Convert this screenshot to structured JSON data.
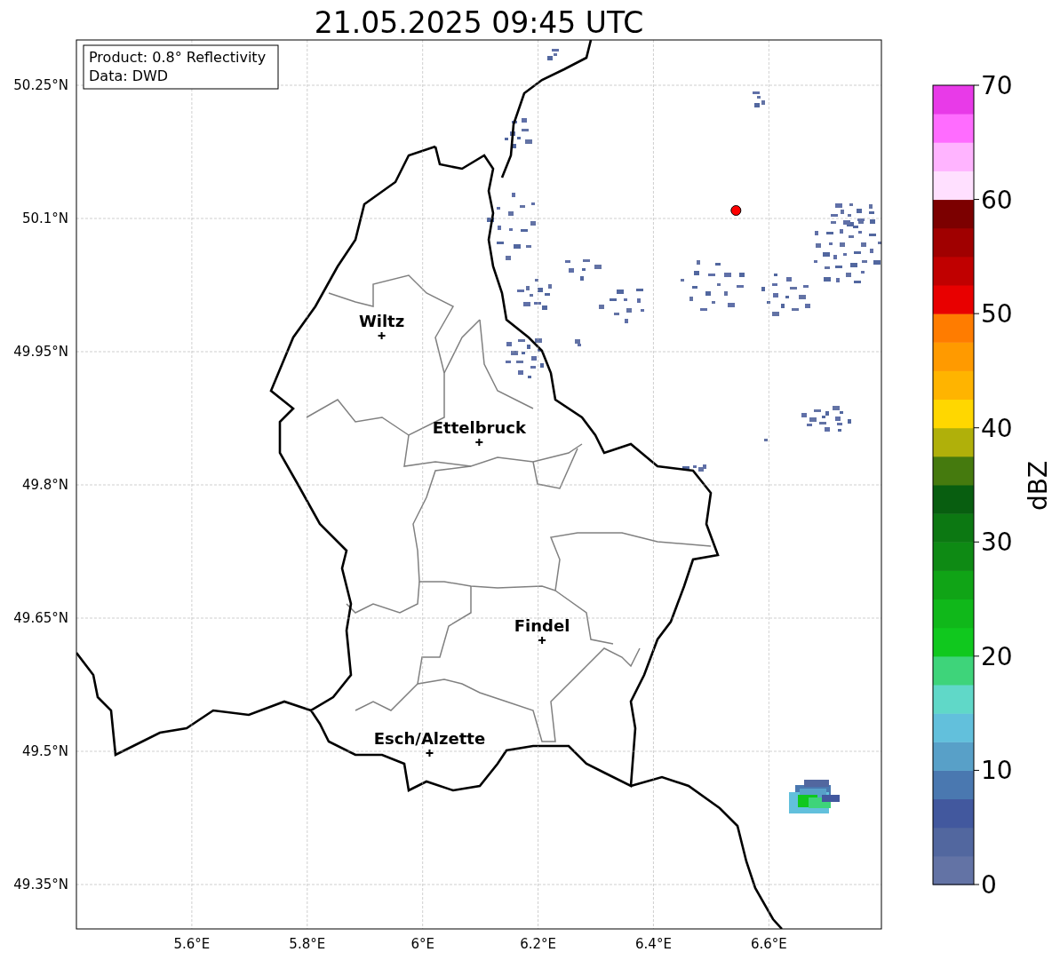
{
  "info_box": {
    "lines": [
      "Product: 0.8° Reflectivity",
      "Data: DWD"
    ]
  },
  "chart_data": {
    "type": "scatter",
    "grid": true,
    "title": "21.05.2025 09:45 UTC",
    "xlim": [
      5.4,
      6.795
    ],
    "ylim": [
      49.3,
      50.301
    ],
    "xticks": [
      {
        "value": 5.6,
        "label": "5.6°E"
      },
      {
        "value": 5.8,
        "label": "5.8°E"
      },
      {
        "value": 6.0,
        "label": "6°E"
      },
      {
        "value": 6.2,
        "label": "6.2°E"
      },
      {
        "value": 6.4,
        "label": "6.4°E"
      },
      {
        "value": 6.6,
        "label": "6.6°E"
      }
    ],
    "yticks": [
      {
        "value": 49.35,
        "label": "49.35°N"
      },
      {
        "value": 49.5,
        "label": "49.5°N"
      },
      {
        "value": 49.65,
        "label": "49.65°N"
      },
      {
        "value": 49.8,
        "label": "49.8°N"
      },
      {
        "value": 49.95,
        "label": "49.95°N"
      },
      {
        "value": 50.1,
        "label": "50.1°N"
      },
      {
        "value": 50.25,
        "label": "50.25°N"
      }
    ],
    "series": [
      {
        "color": "#000000",
        "x": [
          5.929,
          6.098,
          6.207,
          6.012
        ],
        "values": [
          49.968,
          49.848,
          49.625,
          49.498
        ]
      },
      {
        "color": "#ff0000",
        "x": [
          6.543
        ],
        "values": [
          50.109
        ]
      }
    ],
    "annotations": [
      {
        "text": "Wiltz",
        "x": 5.929,
        "y": 49.968
      },
      {
        "text": "Ettelbruck",
        "x": 6.098,
        "y": 49.848
      },
      {
        "text": "Findel",
        "x": 6.207,
        "y": 49.625
      },
      {
        "text": "Esch/Alzette",
        "x": 6.012,
        "y": 49.498
      }
    ]
  },
  "colorbar": {
    "label": "dBZ",
    "ticks": [
      "70",
      "60",
      "50",
      "40",
      "30",
      "20",
      "10",
      "0"
    ],
    "segments": [
      {
        "color": "#6373a5"
      },
      {
        "color": "#52679f"
      },
      {
        "color": "#42589e"
      },
      {
        "color": "#4a78b0"
      },
      {
        "color": "#58a0c8"
      },
      {
        "color": "#62c0dc"
      },
      {
        "color": "#60d8c8"
      },
      {
        "color": "#3ed47a"
      },
      {
        "color": "#10c81e"
      },
      {
        "color": "#10b81a"
      },
      {
        "color": "#10a416"
      },
      {
        "color": "#0e8a14"
      },
      {
        "color": "#0c7812"
      },
      {
        "color": "#085e10"
      },
      {
        "color": "#457a0e"
      },
      {
        "color": "#b0b00a"
      },
      {
        "color": "#ffd700"
      },
      {
        "color": "#ffb400"
      },
      {
        "color": "#ff9a00"
      },
      {
        "color": "#ff7c00"
      },
      {
        "color": "#e80000"
      },
      {
        "color": "#c00000"
      },
      {
        "color": "#a00000"
      },
      {
        "color": "#7c0000"
      },
      {
        "color": "#ffe0ff"
      },
      {
        "color": "#ffb4ff"
      },
      {
        "color": "#ff6cff"
      },
      {
        "color": "#e83ae8"
      }
    ]
  }
}
